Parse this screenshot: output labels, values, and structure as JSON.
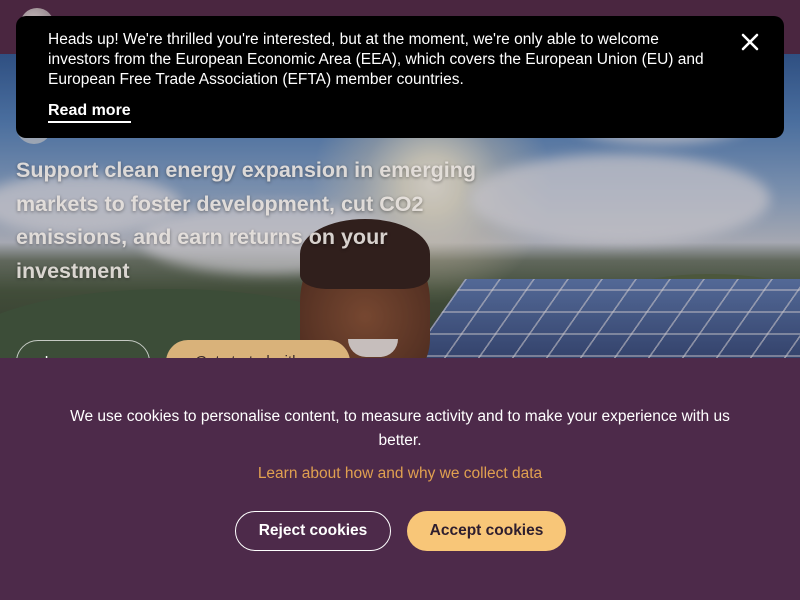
{
  "hero": {
    "headline": "Support clean energy expansion in emerging markets to foster development, cut CO2 emissions, and earn returns on your investment",
    "learn_more_label": "Learn more",
    "get_started_label": "Get started with us"
  },
  "notice": {
    "message": "Heads up! We're thrilled you're interested, but at the moment, we're only able to welcome investors from the European Economic Area (EEA), which covers the European Union (EU) and European Free Trade Association (EFTA) member countries.",
    "link_label": "Read more",
    "close_icon": "close-icon"
  },
  "cookie_banner": {
    "message": "We use cookies to personalise content, to measure activity and to make your experience with us better.",
    "learn_link": "Learn about how and why we collect data",
    "reject_label": "Reject cookies",
    "accept_label": "Accept cookies"
  },
  "colors": {
    "banner_bg": "#4d2a4a",
    "accent": "#f8c678",
    "link": "#e0a050",
    "notice_bg": "#000000"
  }
}
